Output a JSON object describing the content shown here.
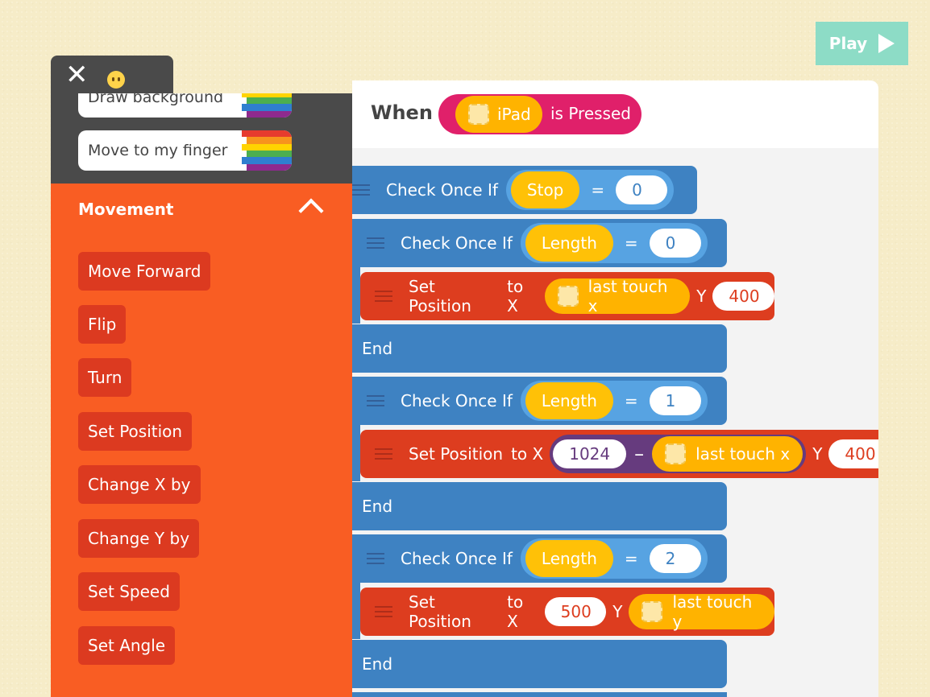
{
  "play": {
    "label": "Play"
  },
  "palette": {
    "close_label": "✕",
    "behaviors": [
      {
        "label": "Draw background"
      },
      {
        "label": "Move to my finger"
      }
    ],
    "stripe_colors": [
      "#e63b2e",
      "#f7941d",
      "#ffd400",
      "#4caf50",
      "#2f7fd0",
      "#8e2a8e"
    ],
    "section": {
      "title": "Movement"
    },
    "movement_blocks": [
      {
        "label": "Move Forward"
      },
      {
        "label": "Flip"
      },
      {
        "label": "Turn"
      },
      {
        "label": "Set Position"
      },
      {
        "label": "Change X by"
      },
      {
        "label": "Change Y by"
      },
      {
        "label": "Set Speed"
      },
      {
        "label": "Set Angle"
      }
    ]
  },
  "editor": {
    "when_label": "When",
    "trigger": {
      "object": "iPad",
      "event": "is Pressed"
    },
    "blocks": {
      "check1": {
        "label": "Check Once If",
        "var": "Stop",
        "eq": "=",
        "value": "0"
      },
      "check2": {
        "label": "Check Once If",
        "var": "Length",
        "eq": "=",
        "value": "0"
      },
      "set1": {
        "label": "Set Position",
        "to_x": "to X",
        "x_var": "last touch x",
        "y_label": "Y",
        "y_value": "400"
      },
      "end1": {
        "label": "End"
      },
      "check3": {
        "label": "Check Once If",
        "var": "Length",
        "eq": "=",
        "value": "1"
      },
      "set2": {
        "label": "Set Position",
        "to_x": "to X",
        "x_num": "1024",
        "minus": "–",
        "x_var": "last touch x",
        "y_label": "Y",
        "y_value": "400"
      },
      "end2": {
        "label": "End"
      },
      "check4": {
        "label": "Check Once If",
        "var": "Length",
        "eq": "=",
        "value": "2"
      },
      "set3": {
        "label": "Set Position",
        "to_x": "to X",
        "x_value": "500",
        "y_label": "Y",
        "y_var": "last touch y"
      },
      "end3": {
        "label": "End"
      }
    }
  },
  "colors": {
    "palette_orange": "#f95d23",
    "block_red": "#dd3d1f",
    "block_blue": "#3e82c2",
    "value_yellow": "#ffc107",
    "trigger_pink": "#e0206a",
    "operator_purple": "#663b7e",
    "play_teal": "#8ddcc6"
  }
}
